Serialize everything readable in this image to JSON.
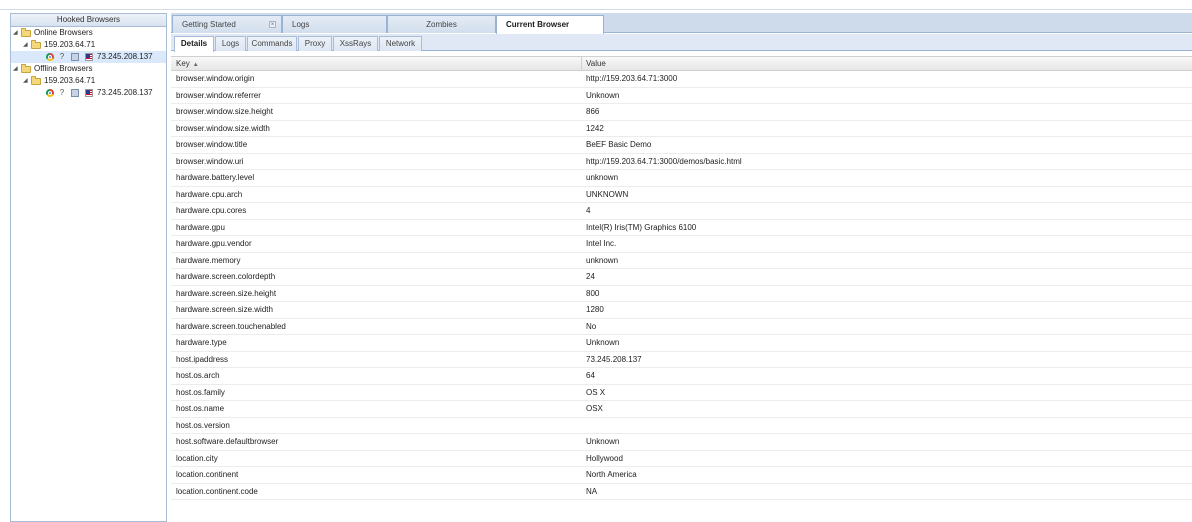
{
  "left_panel": {
    "title": "Hooked Browsers",
    "online_label": "Online Browsers",
    "online_ip": "159.203.64.71",
    "online_browser_ip": "73.245.208.137",
    "offline_label": "Offline Browsers",
    "offline_ip": "159.203.64.71",
    "offline_browser_ip": "73.245.208.137",
    "question_glyph": "?"
  },
  "main_tabs": [
    "Getting Started",
    "Logs",
    "Zombies",
    "Current Browser"
  ],
  "sub_tabs": [
    "Details",
    "Logs",
    "Commands",
    "Proxy",
    "XssRays",
    "Network"
  ],
  "grid": {
    "key_header": "Key",
    "value_header": "Value",
    "sort_glyph": "▲",
    "rows": [
      {
        "key": "browser.window.origin",
        "value": "http://159.203.64.71:3000"
      },
      {
        "key": "browser.window.referrer",
        "value": "Unknown"
      },
      {
        "key": "browser.window.size.height",
        "value": "866"
      },
      {
        "key": "browser.window.size.width",
        "value": "1242"
      },
      {
        "key": "browser.window.title",
        "value": "BeEF Basic Demo"
      },
      {
        "key": "browser.window.uri",
        "value": "http://159.203.64.71:3000/demos/basic.html"
      },
      {
        "key": "hardware.battery.level",
        "value": "unknown"
      },
      {
        "key": "hardware.cpu.arch",
        "value": "UNKNOWN"
      },
      {
        "key": "hardware.cpu.cores",
        "value": "4"
      },
      {
        "key": "hardware.gpu",
        "value": "Intel(R) Iris(TM) Graphics 6100"
      },
      {
        "key": "hardware.gpu.vendor",
        "value": "Intel Inc."
      },
      {
        "key": "hardware.memory",
        "value": "unknown"
      },
      {
        "key": "hardware.screen.colordepth",
        "value": "24"
      },
      {
        "key": "hardware.screen.size.height",
        "value": "800"
      },
      {
        "key": "hardware.screen.size.width",
        "value": "1280"
      },
      {
        "key": "hardware.screen.touchenabled",
        "value": "No"
      },
      {
        "key": "hardware.type",
        "value": "Unknown"
      },
      {
        "key": "host.ipaddress",
        "value": "73.245.208.137"
      },
      {
        "key": "host.os.arch",
        "value": "64"
      },
      {
        "key": "host.os.family",
        "value": "OS X"
      },
      {
        "key": "host.os.name",
        "value": "OSX"
      },
      {
        "key": "host.os.version",
        "value": ""
      },
      {
        "key": "host.software.defaultbrowser",
        "value": "Unknown"
      },
      {
        "key": "location.city",
        "value": "Hollywood"
      },
      {
        "key": "location.continent",
        "value": "North America"
      },
      {
        "key": "location.continent.code",
        "value": "NA"
      }
    ]
  }
}
